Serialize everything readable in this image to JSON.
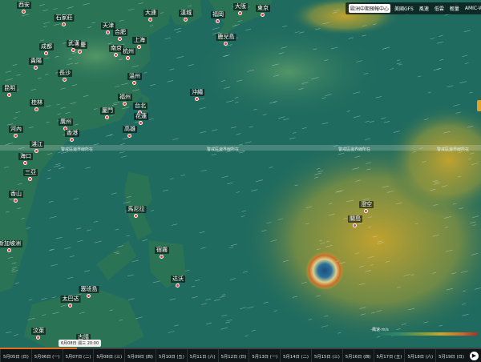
{
  "map": {
    "layer": "wind",
    "cities": [
      {
        "name": "西安"
      },
      {
        "name": "石家莊"
      },
      {
        "name": "天津"
      },
      {
        "name": "大連"
      },
      {
        "name": "漢城"
      },
      {
        "name": "福岡"
      },
      {
        "name": "大阪"
      },
      {
        "name": "東京"
      },
      {
        "name": "重慶"
      },
      {
        "name": "合肥"
      },
      {
        "name": "南京"
      },
      {
        "name": "武漢"
      },
      {
        "name": "上海"
      },
      {
        "name": "鹿兒島"
      },
      {
        "name": "成都"
      },
      {
        "name": "貴陽"
      },
      {
        "name": "長沙"
      },
      {
        "name": "杭州"
      },
      {
        "name": "溫州"
      },
      {
        "name": "福州"
      },
      {
        "name": "沖繩"
      },
      {
        "name": "昆明"
      },
      {
        "name": "桂林"
      },
      {
        "name": "廣州"
      },
      {
        "name": "厦門"
      },
      {
        "name": "台北"
      },
      {
        "name": "花蓮"
      },
      {
        "name": "高雄"
      },
      {
        "name": "香港"
      },
      {
        "name": "河內"
      },
      {
        "name": "湛江"
      },
      {
        "name": "海口"
      },
      {
        "name": "三亞"
      },
      {
        "name": "香山"
      },
      {
        "name": "澄空"
      },
      {
        "name": "馬尼拉"
      },
      {
        "name": "宿霧"
      },
      {
        "name": "达沃"
      },
      {
        "name": "關島"
      },
      {
        "name": "塞班島"
      },
      {
        "name": "太巴达"
      },
      {
        "name": "汶萊"
      },
      {
        "name": "新加坡洲"
      },
      {
        "name": "古晴"
      }
    ],
    "boundary_labels": [
      "警戒區邊界線所在",
      "警戒區邊界線所在",
      "警戒區邊界線所在",
      "警戒區邊界線所在"
    ]
  },
  "model_selector": {
    "active": "歐洲中期預報中心",
    "options": [
      "歐洲中期預報中心",
      "美國GFS",
      "風速",
      "低雲",
      "輕量",
      "AMIC-WRF"
    ]
  },
  "legend": {
    "label": "風速·m/s"
  },
  "timeline": {
    "current_time": "6月08日 週三 20:00",
    "progress": 0.16,
    "days": [
      "5月05日 (日)",
      "5月06日 (一)",
      "5月07日 (二)",
      "5月08日 (三)",
      "5月09日 (四)",
      "5月10日 (五)",
      "5月11日 (六)",
      "5月12日 (日)",
      "5月13日 (一)",
      "5月14日 (二)",
      "5月15日 (三)",
      "5月16日 (四)",
      "5月17日 (五)",
      "5月18日 (六)",
      "5月19日 (日)"
    ]
  },
  "colors": {
    "ocean": "#1f6b5f",
    "land": "#2b7355",
    "wind_high": "#c9a52c",
    "accent": "#e0701f"
  }
}
